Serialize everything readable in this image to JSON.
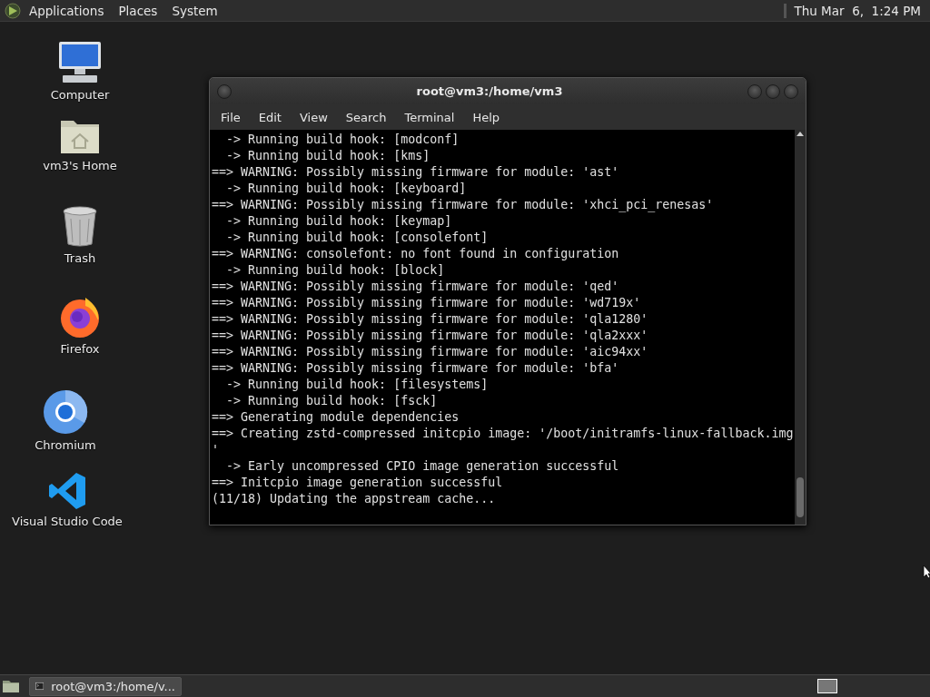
{
  "top_panel": {
    "menus": [
      "Applications",
      "Places",
      "System"
    ],
    "clock": "Thu Mar  6,  1:24 PM"
  },
  "desktop_icons": [
    {
      "kind": "computer",
      "label": "Computer"
    },
    {
      "kind": "home",
      "label": "vm3's Home"
    },
    {
      "kind": "trash",
      "label": "Trash"
    },
    {
      "kind": "firefox",
      "label": "Firefox"
    },
    {
      "kind": "chromium",
      "label": "Chromium"
    },
    {
      "kind": "vscode",
      "label": "Visual Studio Code"
    }
  ],
  "terminal": {
    "title": "root@vm3:/home/vm3",
    "menu": [
      "File",
      "Edit",
      "View",
      "Search",
      "Terminal",
      "Help"
    ],
    "lines": [
      "  -> Running build hook: [modconf]",
      "  -> Running build hook: [kms]",
      "==> WARNING: Possibly missing firmware for module: 'ast'",
      "  -> Running build hook: [keyboard]",
      "==> WARNING: Possibly missing firmware for module: 'xhci_pci_renesas'",
      "  -> Running build hook: [keymap]",
      "  -> Running build hook: [consolefont]",
      "==> WARNING: consolefont: no font found in configuration",
      "  -> Running build hook: [block]",
      "==> WARNING: Possibly missing firmware for module: 'qed'",
      "==> WARNING: Possibly missing firmware for module: 'wd719x'",
      "==> WARNING: Possibly missing firmware for module: 'qla1280'",
      "==> WARNING: Possibly missing firmware for module: 'qla2xxx'",
      "==> WARNING: Possibly missing firmware for module: 'aic94xx'",
      "==> WARNING: Possibly missing firmware for module: 'bfa'",
      "  -> Running build hook: [filesystems]",
      "  -> Running build hook: [fsck]",
      "==> Generating module dependencies",
      "==> Creating zstd-compressed initcpio image: '/boot/initramfs-linux-fallback.img",
      "'",
      "  -> Early uncompressed CPIO image generation successful",
      "==> Initcpio image generation successful",
      "(11/18) Updating the appstream cache..."
    ]
  },
  "taskbar": {
    "tasks": [
      {
        "label": "root@vm3:/home/v...",
        "selected": true
      }
    ]
  }
}
